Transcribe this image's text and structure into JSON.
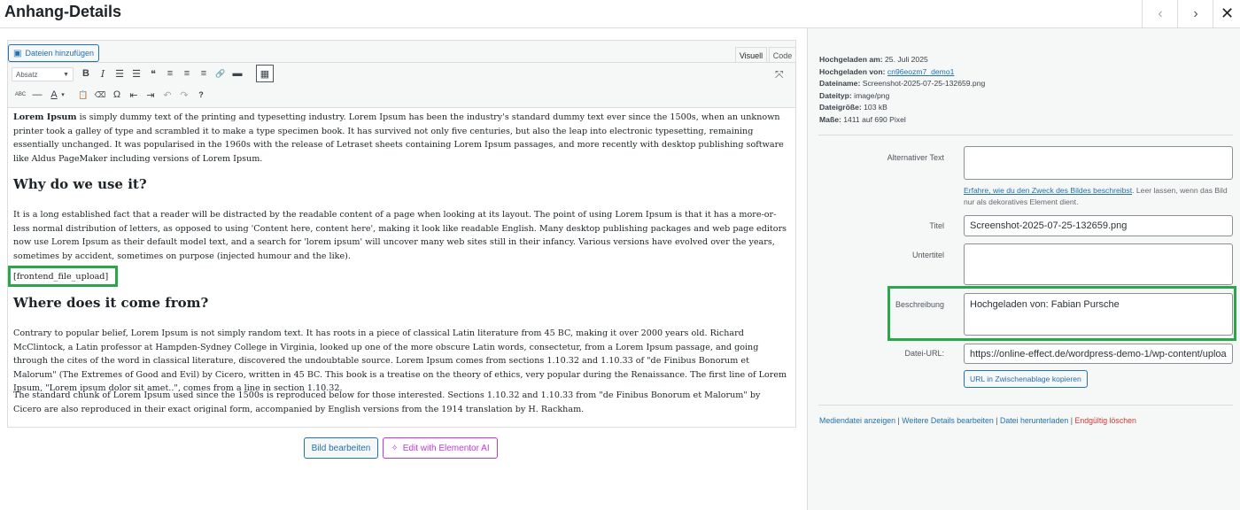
{
  "header": {
    "title": "Anhang-Details",
    "prev_icon": "‹",
    "next_icon": "›",
    "close_icon": "✕"
  },
  "editor": {
    "add_media": "Dateien hinzufügen",
    "tab_visual": "Visuell",
    "tab_code": "Code",
    "format_select": "Absatz",
    "toolbar_row1": [
      "B",
      "I",
      "☰",
      "☰",
      "❝",
      "≡",
      "≡",
      "≡",
      "🔗",
      "▬",
      "▦"
    ],
    "toolbar_row2": [
      "ABC",
      "—",
      "A",
      "▾",
      "📋",
      "⌫",
      "Ω",
      "⇤",
      "⇥",
      "↶",
      "↷",
      "?"
    ],
    "content": {
      "p1_bold": "Lorem Ipsum",
      "p1_rest": " is simply dummy text of the printing and typesetting industry. Lorem Ipsum has been the industry's standard dummy text ever since the 1500s, when an unknown printer took a galley of type and scrambled it to make a type specimen book. It has survived not only five centuries, but also the leap into electronic typesetting, remaining essentially unchanged. It was popularised in the 1960s with the release of Letraset sheets containing Lorem Ipsum passages, and more recently with desktop publishing software like Aldus PageMaker including versions of Lorem Ipsum.",
      "h2_1": "Why do we use it?",
      "p2": "It is a long established fact that a reader will be distracted by the readable content of a page when looking at its layout. The point of using Lorem Ipsum is that it has a more-or-less normal distribution of letters, as opposed to using 'Content here, content here', making it look like readable English. Many desktop publishing packages and web page editors now use Lorem Ipsum as their default model text, and a search for 'lorem ipsum' will uncover many web sites still in their infancy. Various versions have evolved over the years, sometimes by accident, sometimes on purpose (injected humour and the like).",
      "shortcode": "[frontend_file_upload]",
      "h2_2": "Where does it come from?",
      "p3": "Contrary to popular belief, Lorem Ipsum is not simply random text. It has roots in a piece of classical Latin literature from 45 BC, making it over 2000 years old. Richard McClintock, a Latin professor at Hampden-Sydney College in Virginia, looked up one of the more obscure Latin words, consectetur, from a Lorem Ipsum passage, and going through the cites of the word in classical literature, discovered the undoubtable source. Lorem Ipsum comes from sections 1.10.32 and 1.10.33 of \"de Finibus Bonorum et Malorum\" (The Extremes of Good and Evil) by Cicero, written in 45 BC. This book is a treatise on the theory of ethics, very popular during the Renaissance. The first line of Lorem Ipsum, \"Lorem ipsum dolor sit amet..\", comes from a line in section 1.10.32.",
      "p4": "The standard chunk of Lorem Ipsum used since the 1500s is reproduced below for those interested. Sections 1.10.32 and 1.10.33 from \"de Finibus Bonorum et Malorum\" by Cicero are also reproduced in their exact original form, accompanied by English versions from the 1914 translation by H. Rackham."
    }
  },
  "buttons": {
    "edit_image": "Bild bearbeiten",
    "elementor_ai": "Edit with Elementor AI"
  },
  "meta": {
    "uploaded_on_label": "Hochgeladen am:",
    "uploaded_on": " 25. Juli 2025",
    "uploaded_by_label": "Hochgeladen von:",
    "uploaded_by": "cn96eozm7_demo1",
    "filename_label": "Dateiname:",
    "filename": " Screenshot-2025-07-25-132659.png",
    "filetype_label": "Dateityp:",
    "filetype": " image/png",
    "filesize_label": "Dateigröße:",
    "filesize": " 103 kB",
    "dimensions_label": "Maße:",
    "dimensions": " 1411 auf 690 Pixel"
  },
  "fields": {
    "alt_label": "Alternativer Text",
    "alt_value": "",
    "alt_help_link": "Erfahre, wie du den Zweck des Bildes beschreibst",
    "alt_help_rest": ". Leer lassen, wenn das Bild nur als dekoratives Element dient.",
    "title_label": "Titel",
    "title_value": "Screenshot-2025-07-25-132659.png",
    "caption_label": "Untertitel",
    "caption_value": "",
    "description_label": "Beschreibung",
    "description_value": "Hochgeladen von: Fabian Pursche",
    "url_label": "Datei-URL:",
    "url_value": "https://online-effect.de/wordpress-demo-1/wp-content/uploa",
    "copy_button": "URL in Zwischenablage kopieren"
  },
  "actions": {
    "view": "Mediendatei anzeigen",
    "sep": " | ",
    "edit_more": "Weitere Details bearbeiten",
    "download": "Datei herunterladen",
    "delete": "Endgültig löschen"
  },
  "colors": {
    "accent": "#2271b1",
    "highlight": "#2ca64a",
    "danger": "#d63638",
    "elementor": "#c039d8"
  }
}
